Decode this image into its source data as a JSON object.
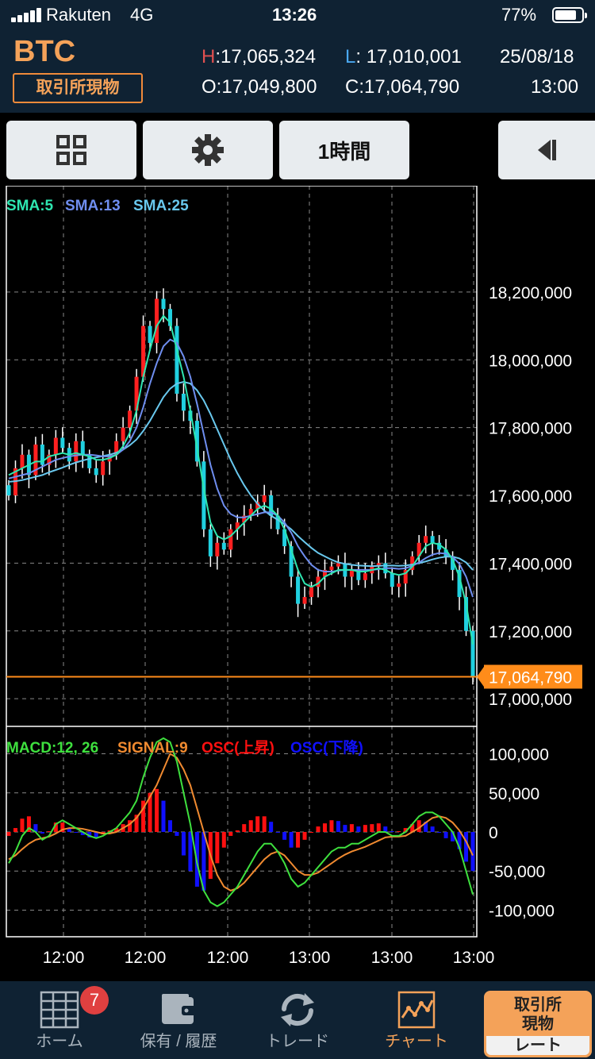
{
  "status_bar": {
    "carrier": "Rakuten",
    "network": "4G",
    "time": "13:26",
    "battery": "77%"
  },
  "header": {
    "symbol": "BTC",
    "market": "取引所現物",
    "high_label": "H",
    "high": ":17,065,324",
    "low_label": "L",
    "low": ": 17,010,001",
    "open_label": "O",
    "open": ":17,049,800",
    "close_label": "C",
    "close": ":17,064,790",
    "date": "25/08/18",
    "time": "13:00"
  },
  "toolbar": {
    "interval": "1時間"
  },
  "indicators": {
    "sma5": "SMA:5",
    "sma13": "SMA:13",
    "sma25": "SMA:25"
  },
  "macd_legend": {
    "macd": "MACD:12, 26",
    "signal": "SIGNAL:9",
    "osc_up": "OSC(上昇)",
    "osc_down": "OSC(下降)"
  },
  "colors": {
    "sma5": "#2ee6b0",
    "sma13": "#6f8ef0",
    "sma25": "#69c8ee",
    "up": "#ff2020",
    "down": "#20d0e0",
    "macd": "#3ee03e",
    "signal": "#f08a30",
    "osc_up": "#ff1010",
    "osc_down": "#1010ff",
    "price_line": "#ff8c1a"
  },
  "chart_data": [
    {
      "type": "candlestick",
      "y_ticks": [
        "18,200,000",
        "18,000,000",
        "17,800,000",
        "17,600,000",
        "17,400,000",
        "17,200,000",
        "17,000,000"
      ],
      "ylim": [
        16930000,
        18420000
      ],
      "current_price": 17064790,
      "current_price_label": "17,064,790",
      "x_ticks": [
        "12:00",
        "12:00",
        "12:00",
        "13:00",
        "13:00",
        "13:00"
      ],
      "close": [
        17600000,
        17680000,
        17720000,
        17660000,
        17750000,
        17690000,
        17720000,
        17770000,
        17740000,
        17700000,
        17760000,
        17720000,
        17680000,
        17660000,
        17700000,
        17720000,
        17760000,
        17800000,
        17850000,
        17950000,
        18100000,
        18050000,
        18180000,
        18150000,
        18100000,
        17900000,
        17850000,
        17820000,
        17700000,
        17500000,
        17420000,
        17460000,
        17440000,
        17500000,
        17520000,
        17540000,
        17560000,
        17580000,
        17600000,
        17540000,
        17500000,
        17450000,
        17360000,
        17280000,
        17300000,
        17330000,
        17360000,
        17380000,
        17390000,
        17400000,
        17360000,
        17380000,
        17350000,
        17370000,
        17390000,
        17400000,
        17370000,
        17330000,
        17340000,
        17380000,
        17420000,
        17460000,
        17480000,
        17460000,
        17440000,
        17420000,
        17380000,
        17300000,
        17200000,
        17064790
      ],
      "sma5": [
        17660000,
        17670000,
        17680000,
        17690000,
        17700000,
        17700000,
        17715000,
        17720000,
        17725000,
        17720000,
        17725000,
        17720000,
        17715000,
        17705000,
        17705000,
        17710000,
        17720000,
        17745000,
        17785000,
        17850000,
        17950000,
        18030000,
        18100000,
        18130000,
        18110000,
        18030000,
        17950000,
        17850000,
        17740000,
        17620000,
        17520000,
        17480000,
        17470000,
        17480000,
        17500000,
        17520000,
        17540000,
        17560000,
        17570000,
        17560000,
        17540000,
        17500000,
        17440000,
        17380000,
        17340000,
        17330000,
        17340000,
        17360000,
        17370000,
        17380000,
        17380000,
        17380000,
        17375000,
        17375000,
        17380000,
        17385000,
        17380000,
        17370000,
        17365000,
        17370000,
        17390000,
        17420000,
        17450000,
        17460000,
        17455000,
        17440000,
        17410000,
        17360000,
        17280000,
        17160000
      ],
      "sma13": [
        17650000,
        17655000,
        17660000,
        17665000,
        17675000,
        17685000,
        17695000,
        17705000,
        17710000,
        17715000,
        17718000,
        17720000,
        17720000,
        17718000,
        17715000,
        17715000,
        17720000,
        17735000,
        17760000,
        17800000,
        17860000,
        17930000,
        17990000,
        18040000,
        18060000,
        18050000,
        18010000,
        17950000,
        17870000,
        17780000,
        17690000,
        17620000,
        17570000,
        17545000,
        17535000,
        17535000,
        17540000,
        17545000,
        17550000,
        17550000,
        17540000,
        17520000,
        17490000,
        17450000,
        17420000,
        17395000,
        17380000,
        17375000,
        17375000,
        17378000,
        17380000,
        17380000,
        17380000,
        17380000,
        17380000,
        17382000,
        17385000,
        17385000,
        17383000,
        17385000,
        17392000,
        17402000,
        17415000,
        17425000,
        17430000,
        17428000,
        17418000,
        17398000,
        17360000,
        17300000
      ],
      "sma25": [
        17640000,
        17642000,
        17645000,
        17650000,
        17655000,
        17660000,
        17668000,
        17675000,
        17682000,
        17690000,
        17697000,
        17703000,
        17708000,
        17712000,
        17716000,
        17720000,
        17726000,
        17735000,
        17748000,
        17765000,
        17790000,
        17820000,
        17855000,
        17890000,
        17915000,
        17930000,
        17935000,
        17930000,
        17910000,
        17880000,
        17840000,
        17795000,
        17750000,
        17705000,
        17665000,
        17630000,
        17600000,
        17575000,
        17555000,
        17540000,
        17528000,
        17515000,
        17500000,
        17480000,
        17462000,
        17445000,
        17430000,
        17420000,
        17410000,
        17402000,
        17398000,
        17395000,
        17393000,
        17392000,
        17391000,
        17392000,
        17393000,
        17393000,
        17392000,
        17393000,
        17396000,
        17400000,
        17405000,
        17411000,
        17416000,
        17419000,
        17419000,
        17414000,
        17402000,
        17380000
      ]
    },
    {
      "type": "macd",
      "y_ticks": [
        "100,000",
        "50,000",
        "0",
        "-50,000",
        "-100,000"
      ],
      "ylim": [
        -130000,
        130000
      ],
      "macd": [
        -40000,
        -25000,
        -5000,
        5000,
        0,
        -10000,
        -5000,
        10000,
        15000,
        10000,
        5000,
        0,
        -5000,
        -8000,
        -5000,
        0,
        5000,
        15000,
        25000,
        40000,
        70000,
        95000,
        115000,
        120000,
        115000,
        90000,
        50000,
        10000,
        -40000,
        -75000,
        -90000,
        -95000,
        -90000,
        -80000,
        -70000,
        -55000,
        -40000,
        -25000,
        -15000,
        -15000,
        -25000,
        -40000,
        -60000,
        -70000,
        -65000,
        -55000,
        -45000,
        -35000,
        -25000,
        -20000,
        -20000,
        -15000,
        -15000,
        -10000,
        -5000,
        0,
        0,
        -5000,
        -5000,
        0,
        10000,
        20000,
        25000,
        25000,
        20000,
        10000,
        0,
        -20000,
        -50000,
        -80000
      ],
      "signal": [
        -35000,
        -30000,
        -22000,
        -15000,
        -10000,
        -8000,
        -6000,
        -2000,
        3000,
        5000,
        5000,
        4000,
        2000,
        0,
        -2000,
        -2000,
        0,
        5000,
        10000,
        18000,
        30000,
        45000,
        60000,
        80000,
        100000,
        95000,
        80000,
        60000,
        30000,
        0,
        -30000,
        -55000,
        -70000,
        -75000,
        -72000,
        -65000,
        -55000,
        -45000,
        -35000,
        -28000,
        -25000,
        -30000,
        -40000,
        -50000,
        -55000,
        -55000,
        -52000,
        -46000,
        -40000,
        -34000,
        -29000,
        -25000,
        -22000,
        -19000,
        -15000,
        -11000,
        -7000,
        -6000,
        -6000,
        -5000,
        0,
        5000,
        12000,
        18000,
        20000,
        18000,
        12000,
        2000,
        -12000,
        -30000
      ]
    }
  ],
  "nav": [
    {
      "label": "ホーム",
      "badge": "7"
    },
    {
      "label": "保有 / 履歴"
    },
    {
      "label": "トレード"
    },
    {
      "label": "チャート"
    }
  ],
  "rate_button": {
    "top": "取引所\n現物",
    "bottom": "レート"
  }
}
